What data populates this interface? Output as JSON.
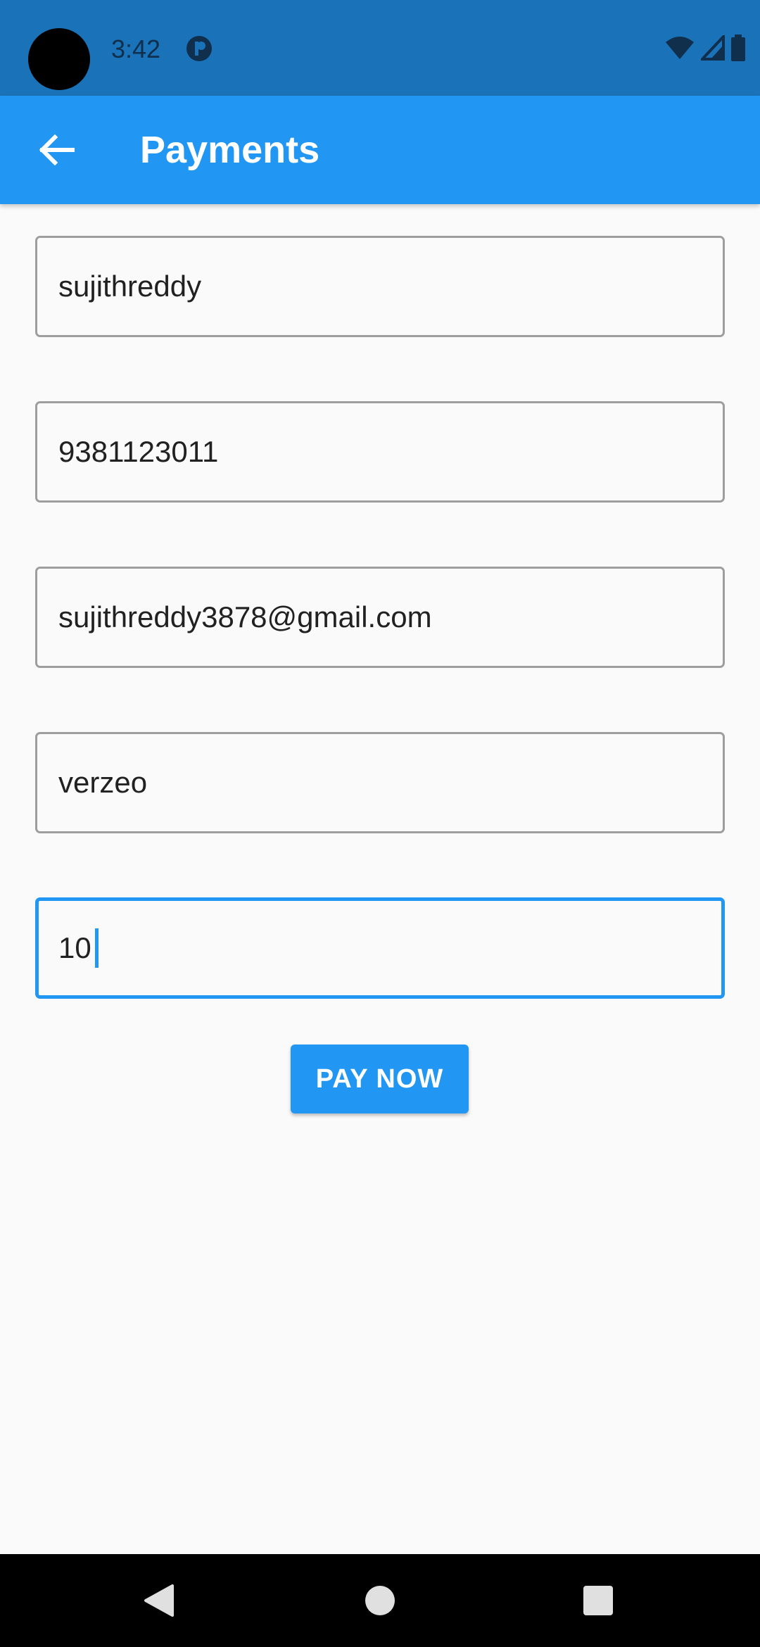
{
  "status_bar": {
    "time": "3:42",
    "app_icon": "circle-logo-icon",
    "wifi_icon": "wifi-icon",
    "signal_icon": "cell-signal-icon",
    "battery_icon": "battery-icon"
  },
  "app_bar": {
    "title": "Payments",
    "back_icon": "arrow-left-icon",
    "background": "#2196F3"
  },
  "form": {
    "fields": [
      {
        "name": "name-field",
        "value": "sujithreddy"
      },
      {
        "name": "phone-field",
        "value": "9381123011"
      },
      {
        "name": "email-field",
        "value": "sujithreddy3878@gmail.com"
      },
      {
        "name": "company-field",
        "value": "verzeo"
      },
      {
        "name": "amount-field",
        "value": "10",
        "focused": true
      }
    ]
  },
  "pay_button": {
    "label": "PAY NOW"
  },
  "nav_bar": {
    "back_icon": "triangle-back-icon",
    "home_icon": "circle-home-icon",
    "recents_icon": "square-recents-icon"
  },
  "colors": {
    "accent": "#2196F3",
    "status_bar": "#1A72B8",
    "background": "#FAFAFA"
  }
}
